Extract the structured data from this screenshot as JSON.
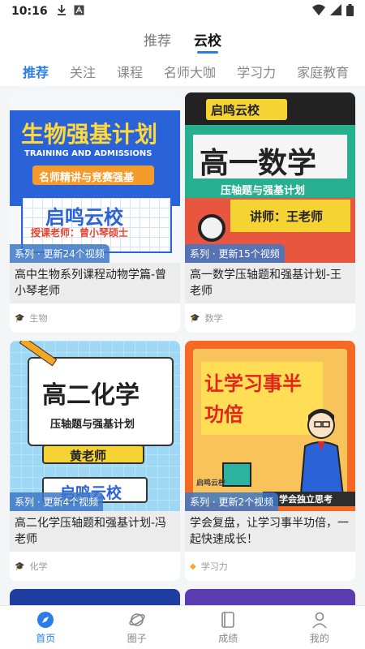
{
  "statusbar": {
    "time": "10:16"
  },
  "header": {
    "top_tabs": [
      "推荐",
      "云校"
    ],
    "categories": [
      "推荐",
      "关注",
      "课程",
      "名师大咖",
      "学习力",
      "家庭教育"
    ]
  },
  "cards": [
    {
      "badge": "系列 · 更新24个视频",
      "title": "高中生物系列课程动物学篇-曾小琴老师",
      "subject": "生物",
      "cover": {
        "headline": "生物强基计划",
        "subline": "TRAINING AND ADMISSIONS",
        "ribbon": "名师精讲与竞赛强基",
        "school": "启鸣云校",
        "teacher": "授课老师：曾小琴硕士"
      }
    },
    {
      "badge": "系列 · 更新15个视频",
      "title": "高一数学压轴题和强基计划-王老师",
      "subject": "数学",
      "cover": {
        "tag": "启鸣云校",
        "headline": "高一数学",
        "subline": "压轴题与强基计划",
        "teacher": "讲师：王老师"
      }
    },
    {
      "badge": "系列 · 更新4个视频",
      "title": "高二化学压轴题和强基计划-冯老师",
      "subject": "化学",
      "cover": {
        "headline": "高二化学",
        "subline": "压轴题与强基计划",
        "teacher": "黄老师",
        "school": "启鸣云校"
      }
    },
    {
      "badge": "系列 · 更新2个视频",
      "title": "学会复盘，让学习事半功倍，一起快速成长！",
      "subject": "学习力",
      "cover": {
        "headline": "让学习事半功倍",
        "strip": "学会独立思考",
        "sign": "启鸣云校"
      }
    }
  ],
  "bottom_nav": [
    {
      "label": "首页",
      "icon": "compass-icon",
      "active": true
    },
    {
      "label": "圈子",
      "icon": "planet-icon",
      "active": false
    },
    {
      "label": "成绩",
      "icon": "book-icon",
      "active": false
    },
    {
      "label": "我的",
      "icon": "person-icon",
      "active": false
    }
  ],
  "colors": {
    "accent": "#2b7de9",
    "badge": "#3c78c8"
  }
}
